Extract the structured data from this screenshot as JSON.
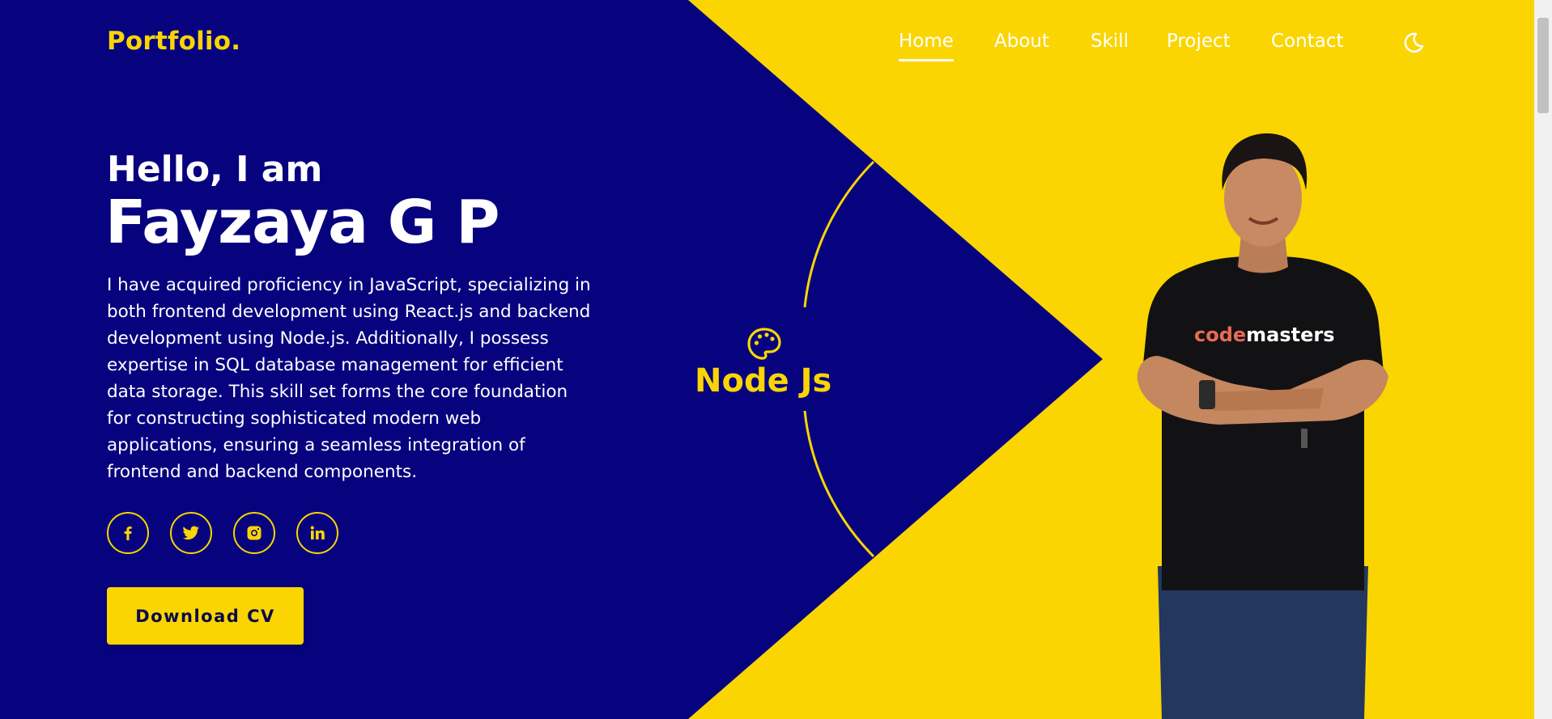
{
  "colors": {
    "primary_blue": "#07037f",
    "accent_yellow": "#fad502",
    "text_white": "#ffffff",
    "button_text": "#0a0a4a"
  },
  "header": {
    "logo": "Portfolio.",
    "nav": [
      {
        "label": "Home",
        "active": true
      },
      {
        "label": "About",
        "active": false
      },
      {
        "label": "Skill",
        "active": false
      },
      {
        "label": "Project",
        "active": false
      },
      {
        "label": "Contact",
        "active": false
      }
    ],
    "theme_icon": "moon-icon"
  },
  "hero": {
    "greeting": "Hello, I am",
    "name": "Fayzaya G P",
    "description": "I have acquired proficiency in JavaScript, specializing in both frontend development using React.js and backend development using Node.js. Additionally, I possess expertise in SQL database management for efficient data storage. This skill set forms the core foundation for constructing sophisticated modern web applications, ensuring a seamless integration of frontend and backend components.",
    "socials": [
      {
        "icon": "facebook-icon"
      },
      {
        "icon": "twitter-icon"
      },
      {
        "icon": "instagram-icon"
      },
      {
        "icon": "linkedin-icon"
      }
    ],
    "download_label": "Download CV"
  },
  "badge": {
    "icon": "palette-icon",
    "label": "Node Js"
  },
  "photo": {
    "shirt_text_highlight": "code",
    "shirt_text_rest": "masters"
  }
}
